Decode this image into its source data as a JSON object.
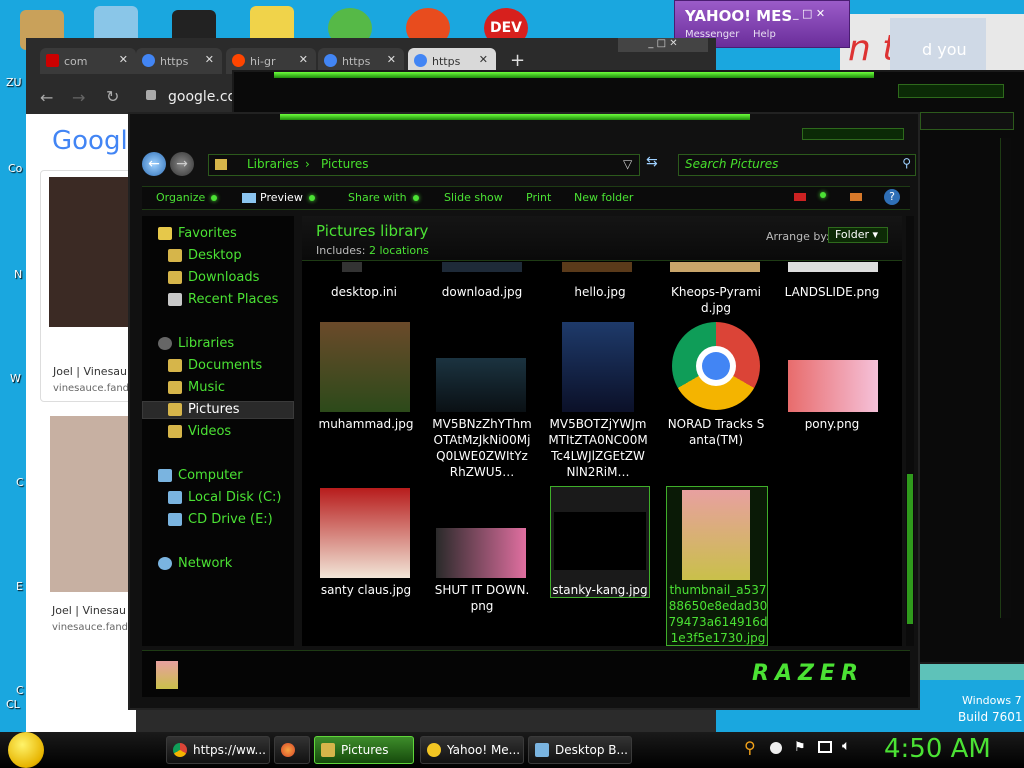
{
  "desktop": {
    "labels": [
      "ZU",
      "Co",
      "N",
      "W",
      "C",
      "E",
      "C",
      "CL"
    ],
    "watermark": {
      "line1": "Windows 7",
      "line2": "Build 7601"
    }
  },
  "browser": {
    "tabs": [
      {
        "label": "com"
      },
      {
        "label": "https"
      },
      {
        "label": "hi-gr"
      },
      {
        "label": "https"
      },
      {
        "label": "https"
      }
    ],
    "url": "google.com",
    "google_logo": "Google",
    "results": [
      {
        "title": "Joel | Vinesau",
        "source": "vinesauce.fand"
      },
      {
        "title": "Joel | Vinesau",
        "source": "vinesauce.fand"
      }
    ]
  },
  "yahoo": {
    "title": "YAHOO! MES",
    "menu": [
      "Messenger",
      "Help"
    ]
  },
  "bg_banner": {
    "text": "n t",
    "text2": "d you"
  },
  "explorer": {
    "breadcrumb": [
      "Libraries",
      "Pictures"
    ],
    "search_placeholder": "Search Pictures",
    "toolbar": {
      "organize": "Organize",
      "preview": "Preview",
      "share": "Share with",
      "slideshow": "Slide show",
      "print": "Print",
      "new_folder": "New folder"
    },
    "nav": {
      "favorites": "Favorites",
      "desktop": "Desktop",
      "downloads": "Downloads",
      "recent": "Recent Places",
      "libraries": "Libraries",
      "documents": "Documents",
      "music": "Music",
      "pictures": "Pictures",
      "videos": "Videos",
      "computer": "Computer",
      "localdisk": "Local Disk (C:)",
      "cddrive": "CD Drive (E:)",
      "network": "Network"
    },
    "library": {
      "title": "Pictures library",
      "includes_label": "Includes:",
      "includes_link": "2 locations",
      "arrange_label": "Arrange by:",
      "arrange_value": "Folder"
    },
    "files_row1": [
      "desktop.ini",
      "download.jpg",
      "hello.jpg",
      "Kheops-Pyramid.jpg",
      "LANDSLIDE.png"
    ],
    "files_row2": [
      "muhammad.jpg",
      "MV5BNzZhYThmOTAtMzJkNi00MjQ0LWE0ZWItYzRhZWU5…",
      "MV5BOTZjYWJmMTItZTA0NC00MTc4LWJlZGEtZWNlN2RiM…",
      "NORAD Tracks Santa(TM)",
      "pony.png"
    ],
    "files_row3": [
      "santy claus.jpg",
      "SHUT IT DOWN.png",
      "stanky-kang.jpg",
      "thumbnail_a53788650e8edad3079473a614916d1e3f5e1730.jpg"
    ],
    "brand": "RAZER"
  },
  "taskbar": {
    "items": [
      "https://ww...",
      "",
      "Pictures",
      "Yahoo! Me...",
      "Desktop B..."
    ],
    "clock": "4:50 AM"
  }
}
